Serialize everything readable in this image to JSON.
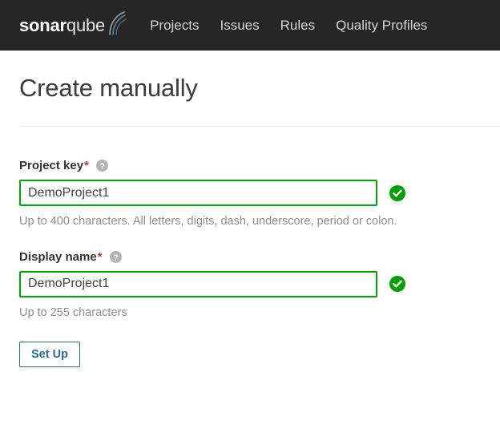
{
  "navbar": {
    "logo": {
      "bold_part": "sonar",
      "light_part": "qube"
    },
    "links": [
      {
        "label": "Projects"
      },
      {
        "label": "Issues"
      },
      {
        "label": "Rules"
      },
      {
        "label": "Quality Profiles"
      }
    ]
  },
  "page": {
    "title": "Create manually"
  },
  "form": {
    "project_key": {
      "label": "Project key",
      "required_marker": "*",
      "value": "DemoProject1",
      "placeholder": "",
      "hint": "Up to 400 characters. All letters, digits, dash, underscore, period or colon.",
      "help_icon": "question-circle-icon",
      "status_icon": "check-circle-icon"
    },
    "display_name": {
      "label": "Display name",
      "required_marker": "*",
      "value": "DemoProject1",
      "placeholder": "",
      "hint": "Up to 255 characters",
      "help_icon": "question-circle-icon",
      "status_icon": "check-circle-icon"
    },
    "submit_label": "Set Up"
  },
  "colors": {
    "navbar_bg": "#262626",
    "valid_green": "#00aa00",
    "required_red": "#c0342c",
    "button_blue": "#236a97",
    "title_gray": "#3c3c3c",
    "hint_gray": "#8d8d8d"
  }
}
